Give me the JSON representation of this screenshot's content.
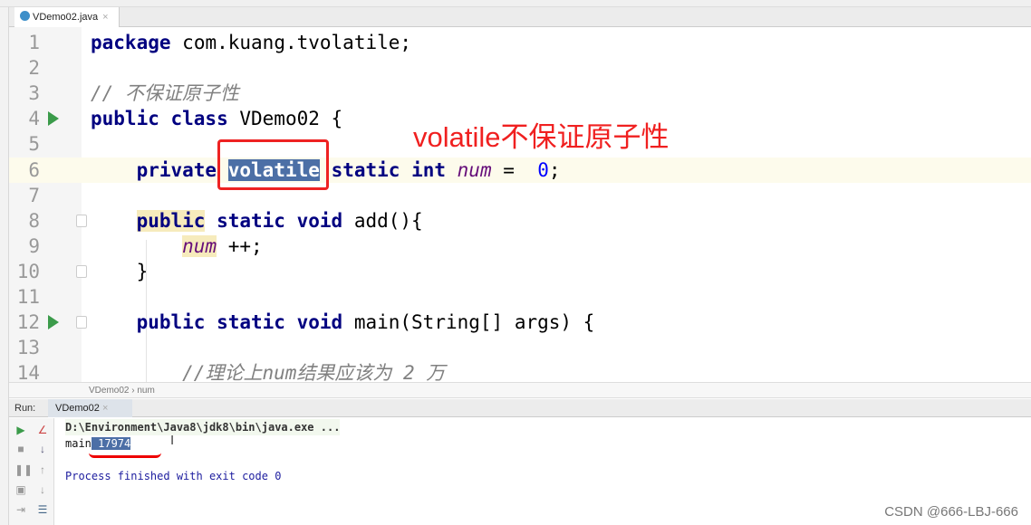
{
  "tab": {
    "filename": "VDemo02.java",
    "close": "×"
  },
  "editor": {
    "lines": [
      {
        "n": "1",
        "parts": [
          [
            "kw",
            "package"
          ],
          [
            "",
            "com.kuang.tvolatile;"
          ]
        ]
      },
      {
        "n": "2",
        "parts": []
      },
      {
        "n": "3",
        "parts": [
          [
            "cm",
            "// 不保证原子性"
          ]
        ]
      },
      {
        "n": "4",
        "parts": [
          [
            "kw",
            "public class"
          ],
          [
            "",
            "VDemo02 {"
          ]
        ],
        "run": true
      },
      {
        "n": "5",
        "parts": []
      },
      {
        "n": "6",
        "parts": [
          [
            "",
            "    "
          ],
          [
            "kw",
            "private"
          ],
          [
            "sel",
            "volatile"
          ],
          [
            "kw",
            "static int"
          ],
          [
            "it",
            "num"
          ],
          [
            "",
            "= "
          ],
          [
            "num",
            "0"
          ],
          [
            "",
            ";"
          ]
        ],
        "cur": true
      },
      {
        "n": "7",
        "parts": []
      },
      {
        "n": "8",
        "parts": [
          [
            "",
            "    "
          ],
          [
            "kw hl",
            "public"
          ],
          [
            "kw",
            "static void"
          ],
          [
            "",
            "add(){"
          ]
        ],
        "fold": true
      },
      {
        "n": "9",
        "parts": [
          [
            "",
            "        "
          ],
          [
            "it hl",
            "num"
          ],
          [
            "",
            "++;"
          ]
        ]
      },
      {
        "n": "10",
        "parts": [
          [
            "",
            "    }"
          ]
        ],
        "fold": true
      },
      {
        "n": "11",
        "parts": []
      },
      {
        "n": "12",
        "parts": [
          [
            "",
            "    "
          ],
          [
            "kw",
            "public static void"
          ],
          [
            "",
            "main(String[] args) {"
          ]
        ],
        "run": true,
        "fold": true
      },
      {
        "n": "13",
        "parts": []
      },
      {
        "n": "14",
        "parts": [
          [
            "",
            "        "
          ],
          [
            "cm",
            "//理论上num结果应该为 2 万"
          ]
        ]
      }
    ]
  },
  "annotation": "volatile不保证原子性",
  "breadcrumb": {
    "class": "VDemo02",
    "sep": "›",
    "field": "num"
  },
  "run": {
    "label": "Run:",
    "tab": "VDemo02",
    "close": "×"
  },
  "console": {
    "cmd": "D:\\Environment\\Java8\\jdk8\\bin\\java.exe ...",
    "prefix": "main",
    "value": " 17974",
    "exit": "Process finished with exit code 0"
  },
  "watermark": "CSDN @666-LBJ-666"
}
